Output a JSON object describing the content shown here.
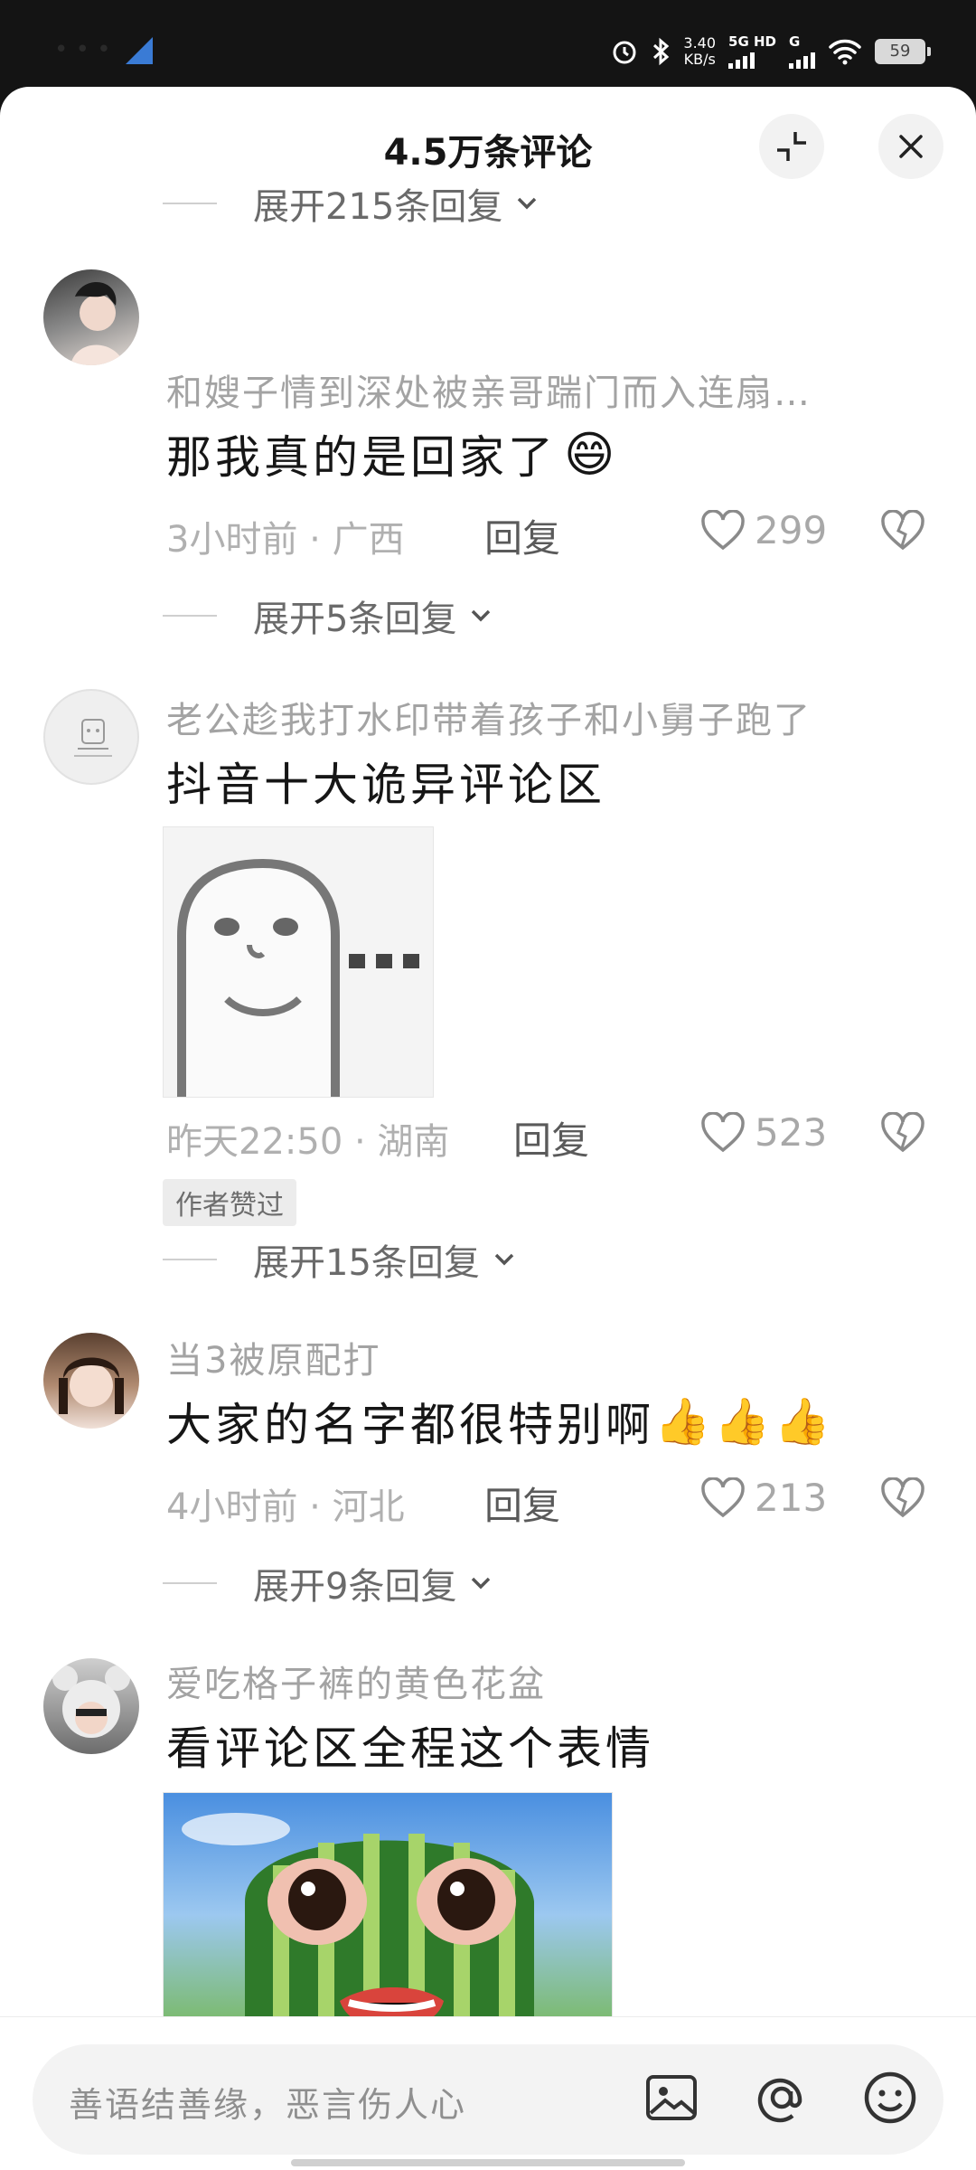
{
  "status": {
    "time_hidden": "• • •",
    "speed_value": "3.40",
    "speed_unit": "KB/s",
    "network": "5G HD",
    "network2": "G",
    "battery": "59"
  },
  "header": {
    "title": "4.5万条评论"
  },
  "top_expand": {
    "label": "展开215条回复"
  },
  "comments": [
    {
      "user": "和嫂子情到深处被亲哥踹门而入连扇…",
      "text": "那我真的是回家了",
      "emoji": "😄",
      "time": "3小时前 · 广西",
      "reply": "回复",
      "likes": "299",
      "expand": "展开5条回复"
    },
    {
      "user": "老公趁我打水印带着孩子和小舅子跑了",
      "text": "抖音十大诡异评论区",
      "time": "昨天22:50 · 湖南",
      "reply": "回复",
      "likes": "523",
      "badge": "作者赞过",
      "expand": "展开15条回复"
    },
    {
      "user": "当3被原配打",
      "text": "大家的名字都很特别啊",
      "emoji": "👍👍👍",
      "time": "4小时前 · 河北",
      "reply": "回复",
      "likes": "213",
      "expand": "展开9条回复"
    },
    {
      "user": "爱吃格子裤的黄色花盆",
      "text": "看评论区全程这个表情"
    }
  ],
  "input": {
    "placeholder": "善语结善缘，恶言伤人心"
  },
  "colors": {
    "accent": "#161616",
    "muted": "#a3a3a3",
    "background": "#ffffff"
  }
}
